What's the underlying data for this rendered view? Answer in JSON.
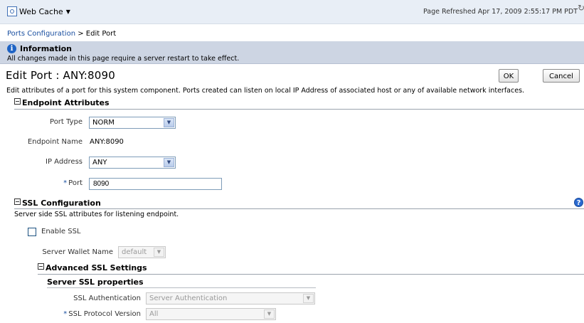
{
  "header": {
    "menu_label": "Web Cache",
    "refreshed": "Page Refreshed Apr 17, 2009 2:55:17 PM PDT"
  },
  "breadcrumb": {
    "link": "Ports Configuration",
    "separator": ">",
    "current": "Edit Port"
  },
  "info": {
    "title": "Information",
    "text": "All changes made in this page require a server restart to take effect."
  },
  "page": {
    "title": "Edit Port : ANY:8090",
    "ok_label": "OK",
    "cancel_label": "Cancel",
    "description": "Edit attributes of a port for this system component. Ports created can listen on local IP Address of associated host or any of available network interfaces."
  },
  "endpoint": {
    "heading": "Endpoint Attributes",
    "port_type_label": "Port Type",
    "port_type_value": "NORM",
    "endpoint_name_label": "Endpoint Name",
    "endpoint_name_value": "ANY:8090",
    "ip_address_label": "IP Address",
    "ip_address_value": "ANY",
    "port_label": "Port",
    "port_value": "8090"
  },
  "ssl": {
    "heading": "SSL Configuration",
    "description": "Server side SSL attributes for listening endpoint.",
    "enable_label": "Enable SSL",
    "enabled": false,
    "wallet_label": "Server Wallet Name",
    "wallet_value": "default",
    "advanced_heading": "Advanced SSL Settings",
    "properties_heading": "Server SSL properties",
    "auth_label": "SSL Authentication",
    "auth_value": "Server Authentication",
    "protocol_label": "SSL Protocol Version",
    "protocol_value": "All"
  },
  "icons": {
    "menu": "web-cache-icon",
    "info": "information-icon",
    "help": "help-icon",
    "refresh": "refresh-icon"
  },
  "colors": {
    "topbar": "#e8eef6",
    "info_banner": "#cdd5e3",
    "link": "#1a4fa0",
    "help_icon": "#2a6ad0"
  }
}
